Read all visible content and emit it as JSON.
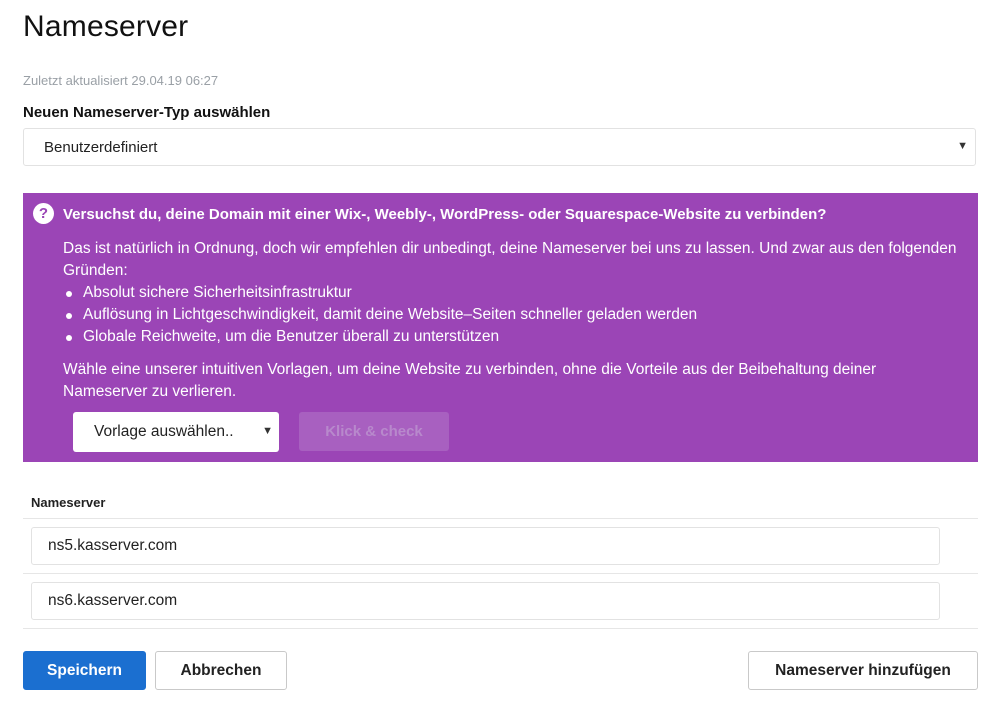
{
  "page": {
    "title": "Nameserver",
    "updated": "Zuletzt aktualisiert 29.04.19 06:27"
  },
  "type_select": {
    "label": "Neuen Nameserver-Typ auswählen",
    "value": "Benutzerdefiniert"
  },
  "promo": {
    "icon": "question-circle-icon",
    "title": "Versuchst du, deine Domain mit einer Wix-, Weebly-, WordPress- oder Squarespace-Website zu verbinden?",
    "intro": "Das ist natürlich in Ordnung, doch wir empfehlen dir unbedingt, deine Nameserver bei uns zu lassen. Und zwar aus den folgenden Gründen:",
    "reasons": [
      "Absolut sichere Sicherheitsinfrastruktur",
      "Auflösung in Lichtgeschwindigkeit, damit deine Website–Seiten schneller geladen werden",
      "Globale Reichweite, um die Benutzer überall zu unterstützen"
    ],
    "outro": "Wähle eine unserer intuitiven Vorlagen, um deine Website zu verbinden, ohne die Vorteile aus der Beibehaltung deiner Nameserver zu verlieren.",
    "template_select": "Vorlage auswählen..",
    "check_button": "Klick & check",
    "background_color": "#9b45b6"
  },
  "nameservers": {
    "header": "Nameserver",
    "entries": [
      "ns5.kasserver.com",
      "ns6.kasserver.com"
    ]
  },
  "actions": {
    "save": "Speichern",
    "cancel": "Abbrechen",
    "add": "Nameserver hinzufügen",
    "primary_color": "#1b6fd0"
  }
}
